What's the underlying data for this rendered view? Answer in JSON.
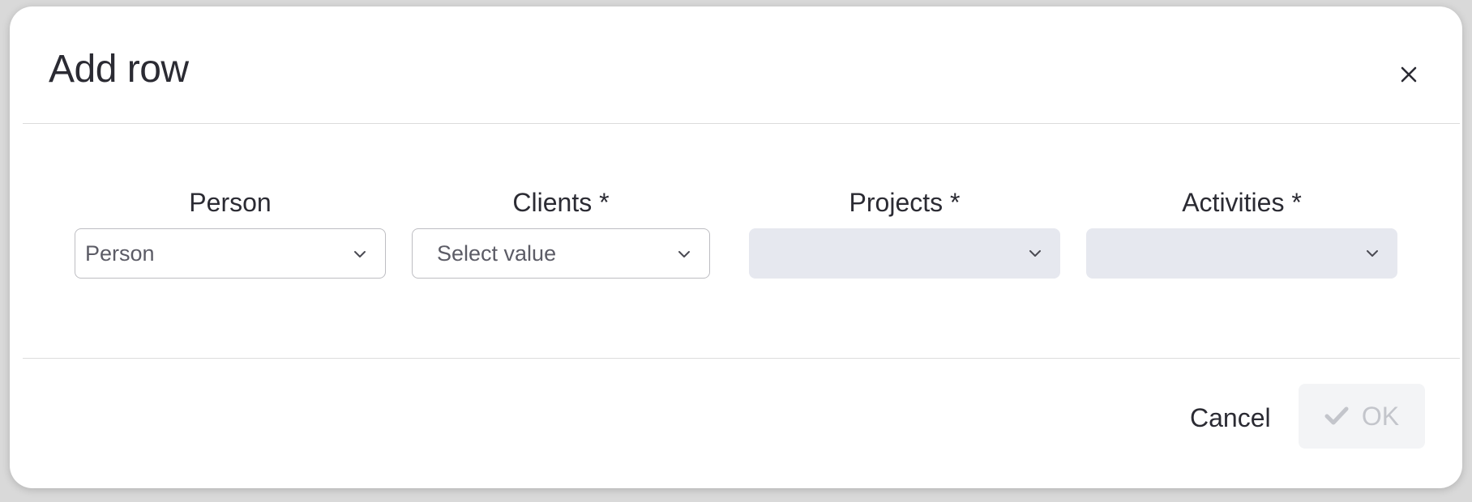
{
  "dialog": {
    "title": "Add row",
    "close_icon": "close-icon"
  },
  "fields": [
    {
      "label": "Person",
      "value": "Person",
      "state": "enabled"
    },
    {
      "label": "Clients *",
      "placeholder": "Select value",
      "state": "enabled"
    },
    {
      "label": "Projects *",
      "value": "",
      "state": "disabled"
    },
    {
      "label": "Activities *",
      "value": "",
      "state": "disabled"
    }
  ],
  "footer": {
    "cancel_label": "Cancel",
    "ok_label": "OK",
    "ok_icon": "checkmark-icon",
    "ok_enabled": false
  },
  "colors": {
    "disabled_field_bg": "#e6e8ef",
    "disabled_button_bg": "#f3f4f6",
    "disabled_text": "#c3c5cb",
    "text": "#2b2b33"
  }
}
